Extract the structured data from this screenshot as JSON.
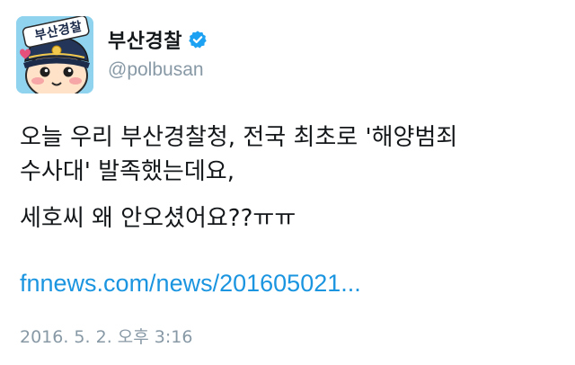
{
  "account": {
    "display_name": "부산경찰",
    "handle": "@polbusan",
    "avatar_text": "부산경찰",
    "verified": true
  },
  "tweet": {
    "line1": "오늘 우리 부산경찰청, 전국 최초로  '해양범죄",
    "line2": "수사대' 발족했는데요,",
    "line3": "세호씨 왜 안오셨어요??ㅠㅠ",
    "link": "fnnews.com/news/201605021...",
    "timestamp": "2016. 5. 2. 오후 3:16"
  },
  "colors": {
    "avatar_bg": "#8fd3ef",
    "link": "#1b95e0",
    "verified": "#1da1f2",
    "muted": "#8899a6"
  }
}
